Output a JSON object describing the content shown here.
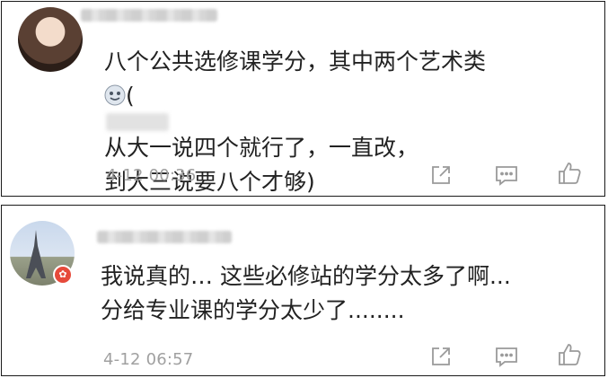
{
  "comments": [
    {
      "lines": [
        "八个公共选修课学分，其中两个艺术类",
        "从大一说四个就行了，一直改，",
        "到大三说要八个才够)"
      ],
      "line2_prefix": "(",
      "time": "4-12 00:36"
    },
    {
      "lines": [
        "我说真的… 这些必修站的学分太多了啊...",
        "分给专业课的学分太少了........"
      ],
      "time": "4-12 06:57"
    }
  ],
  "icons": {
    "share": "share-icon",
    "reply": "comment-icon",
    "like": "thumbs-up-icon"
  },
  "colors": {
    "text": "#222222",
    "meta": "#a0a0a0",
    "icon": "#9a9a9a",
    "badge": "#e64a3b"
  }
}
